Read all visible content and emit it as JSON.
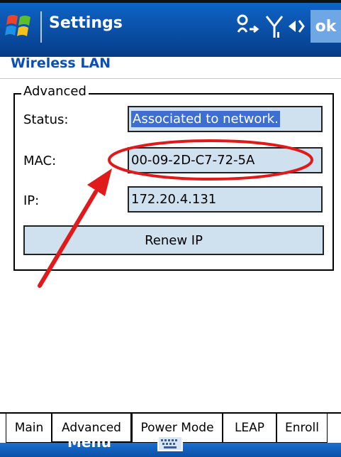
{
  "title_bar": {
    "app_title": "Settings",
    "ok_label": "ok",
    "icons": [
      "windows-logo-icon",
      "connectivity-icon",
      "signal-icon",
      "speaker-icon"
    ]
  },
  "page": {
    "subtitle": "Wireless LAN"
  },
  "advanced_group": {
    "legend": "Advanced",
    "status_label": "Status:",
    "status_value": "Associated to network.",
    "mac_label": "MAC:",
    "mac_value": "00-09-2D-C7-72-5A",
    "ip_label": "IP:",
    "ip_value": "172.20.4.131",
    "renew_button": "Renew IP"
  },
  "tabs": [
    {
      "label": "Main",
      "active": false
    },
    {
      "label": "Advanced",
      "active": true
    },
    {
      "label": "Power Mode",
      "active": false
    },
    {
      "label": "LEAP",
      "active": false
    },
    {
      "label": "Enroll",
      "active": false
    }
  ],
  "softkeys": {
    "left": "Menu",
    "center_icon": "keyboard-icon"
  },
  "colors": {
    "title_bar": "#0a4fa6",
    "subtitle_text": "#0a4fb5",
    "field_bg": "#cfe0ef",
    "selection": "#3c6fd0",
    "annotation": "#e01a1a"
  }
}
